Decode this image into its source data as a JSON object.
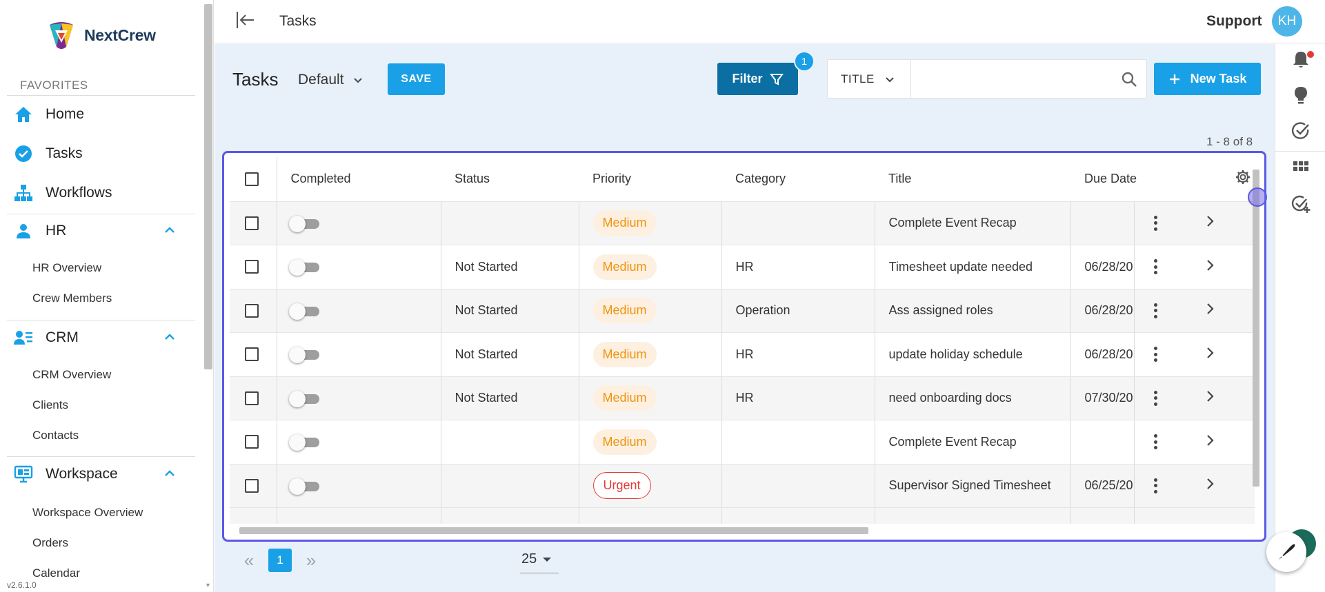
{
  "app": {
    "name": "NextCrew",
    "version": "v2.6.1.0"
  },
  "colors": {
    "accent": "#1aa0e6",
    "filter": "#0b6fa3",
    "medium": "#f0930c",
    "urgent": "#e53935",
    "highlight": "#5b57e6"
  },
  "sidebar": {
    "favorites_label": "FAVORITES",
    "items": [
      {
        "label": "Home",
        "icon": "home-icon"
      },
      {
        "label": "Tasks",
        "icon": "check-circle-icon"
      },
      {
        "label": "Workflows",
        "icon": "sitemap-icon"
      }
    ],
    "sections": [
      {
        "label": "HR",
        "icon": "person-icon",
        "children": [
          "HR Overview",
          "Crew Members"
        ]
      },
      {
        "label": "CRM",
        "icon": "contacts-list-icon",
        "children": [
          "CRM Overview",
          "Clients",
          "Contacts"
        ]
      },
      {
        "label": "Workspace",
        "icon": "workspace-icon",
        "children": [
          "Workspace Overview",
          "Orders",
          "Calendar"
        ]
      }
    ]
  },
  "topbar": {
    "title": "Tasks",
    "support": "Support",
    "avatar_initials": "KH"
  },
  "toolbar": {
    "page_title": "Tasks",
    "view_name": "Default",
    "save_label": "SAVE",
    "filter_label": "Filter",
    "filter_count": "1",
    "search_field": "TITLE",
    "search_value": "",
    "new_task_label": "New Task"
  },
  "table": {
    "range": "1 - 8 of 8",
    "columns": [
      "Completed",
      "Status",
      "Priority",
      "Category",
      "Title",
      "Due Date"
    ],
    "rows": [
      {
        "status": "",
        "priority": "Medium",
        "category": "",
        "title": "Complete Event Recap",
        "due": ""
      },
      {
        "status": "Not Started",
        "priority": "Medium",
        "category": "HR",
        "title": "Timesheet update needed",
        "due": "06/28/20"
      },
      {
        "status": "Not Started",
        "priority": "Medium",
        "category": "Operation",
        "title": "Ass assigned roles",
        "due": "06/28/20"
      },
      {
        "status": "Not Started",
        "priority": "Medium",
        "category": "HR",
        "title": "update holiday schedule",
        "due": "06/28/20"
      },
      {
        "status": "Not Started",
        "priority": "Medium",
        "category": "HR",
        "title": "need onboarding docs",
        "due": "07/30/20"
      },
      {
        "status": "",
        "priority": "Medium",
        "category": "",
        "title": "Complete Event Recap",
        "due": ""
      },
      {
        "status": "",
        "priority": "Urgent",
        "category": "",
        "title": "Supervisor Signed Timesheet",
        "due": "06/25/20"
      }
    ]
  },
  "pagination": {
    "current_page": "1",
    "page_size": "25"
  }
}
